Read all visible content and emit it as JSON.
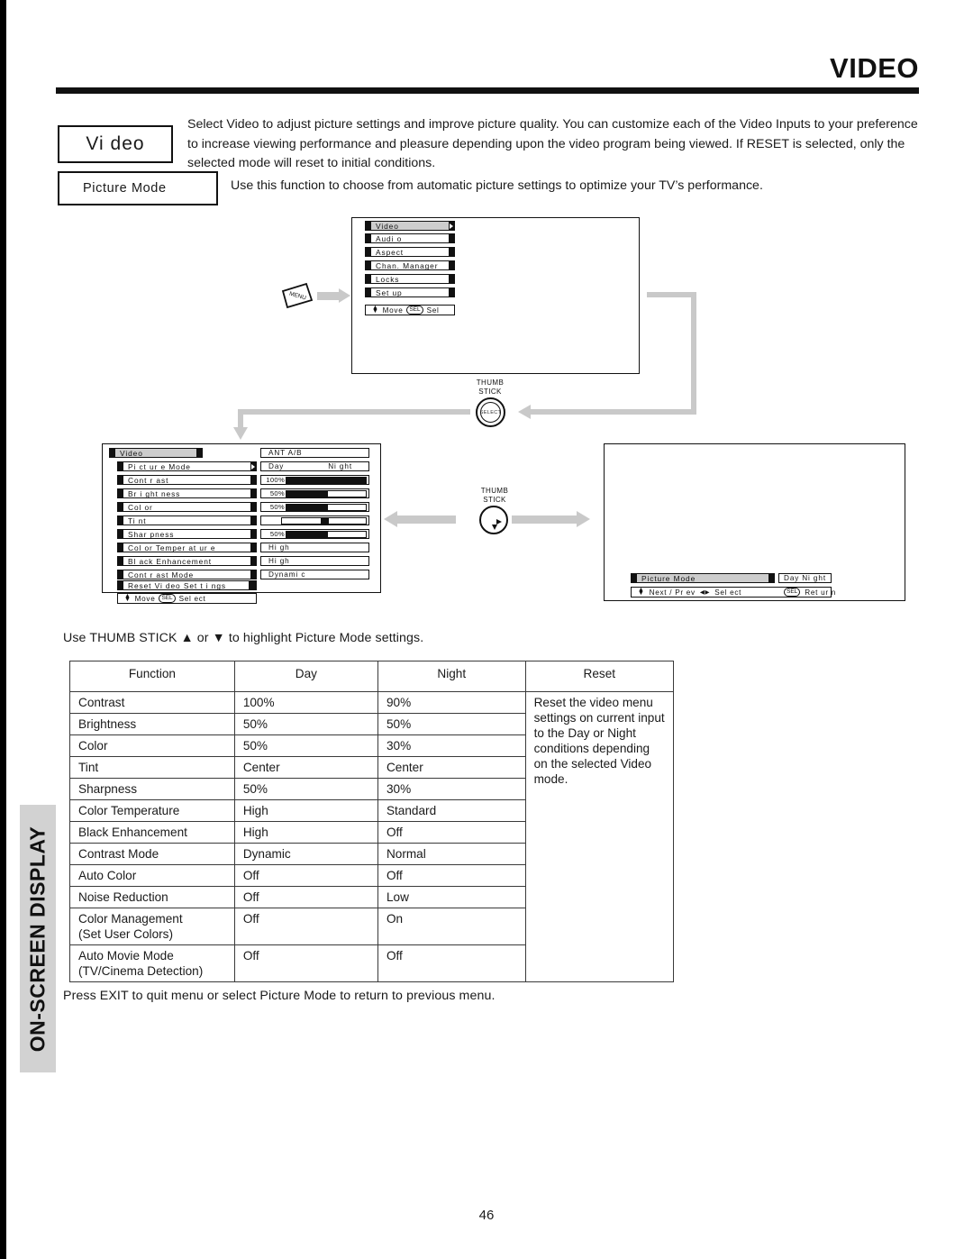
{
  "page": {
    "header_title": "VIDEO",
    "page_number": "46",
    "sidebar_label": "ON-SCREEN DISPLAY"
  },
  "intro": {
    "badge": "Vi deo",
    "paragraph": "Select Video to adjust picture settings and improve picture quality.  You can customize each of the Video Inputs to your preference to increase viewing performance and pleasure depending upon the video program being viewed.  If RESET is selected, only the selected mode will reset to initial conditions.",
    "feature_badge": "Picture Mode",
    "feature_text": "Use this function to choose from automatic picture settings to optimize your TV’s performance."
  },
  "diagram": {
    "menu_key_label": "MENU",
    "thumb_stick_label_1": "THUMB",
    "thumb_stick_label_2": "STICK",
    "select_label": "SELECT",
    "main_menu": {
      "items": [
        "Video",
        "Audi o",
        "Aspect",
        "Chan.  Manager",
        "Locks",
        "Set up"
      ],
      "selected": "Video",
      "guide_move": "Move",
      "guide_sel_key": "SEL",
      "guide_sel": "Sel"
    },
    "video_menu": {
      "title": "Video",
      "input_label": "ANT A/B",
      "rows": [
        {
          "label": "Pi ct ur e  Mode",
          "type": "submenu",
          "value_day": "Day",
          "value_night": "Ni ght"
        },
        {
          "label": "Cont r ast",
          "type": "bar",
          "pct": "100%",
          "fill": 100
        },
        {
          "label": "Br i ght ness",
          "type": "bar",
          "pct": "50%",
          "fill": 52
        },
        {
          "label": "Col or",
          "type": "bar",
          "pct": "50%",
          "fill": 52
        },
        {
          "label": "Ti nt",
          "type": "center",
          "pct": "",
          "fill": 50
        },
        {
          "label": "Shar pness",
          "type": "bar",
          "pct": "50%",
          "fill": 52
        },
        {
          "label": "Col or   Temper at ur e",
          "type": "text",
          "value": "Hi gh"
        },
        {
          "label": "Bl ack  Enhancement",
          "type": "text",
          "value": "Hi gh"
        },
        {
          "label": "Cont r ast   Mode",
          "type": "text",
          "value": "Dynami c"
        },
        {
          "label": "Reset   Vi deo  Set t i ngs",
          "type": "scroll",
          "value": ""
        }
      ],
      "guide_move": "Move",
      "guide_sel_key": "SEL",
      "guide_sel": "Sel ect"
    },
    "picture_mode_bar": {
      "label": "Picture Mode",
      "value_day": "Day",
      "value_night": "Ni ght",
      "guide_nextprev": "Next / Pr ev",
      "guide_select": "Sel ect",
      "guide_return_key": "SEL",
      "guide_return": "Ret ur n"
    }
  },
  "instructions": {
    "above_table": "Use THUMB STICK ▲ or ▼ to highlight Picture Mode settings.",
    "below_table": "Press EXIT to quit menu or select Picture Mode to return to previous menu."
  },
  "table": {
    "headers": [
      "Function",
      "Day",
      "Night",
      "Reset"
    ],
    "rows": [
      {
        "function": "Contrast",
        "day": "100%",
        "night": "90%"
      },
      {
        "function": "Brightness",
        "day": "50%",
        "night": "50%"
      },
      {
        "function": "Color",
        "day": "50%",
        "night": "30%"
      },
      {
        "function": "Tint",
        "day": "Center",
        "night": "Center"
      },
      {
        "function": "Sharpness",
        "day": "50%",
        "night": "30%"
      },
      {
        "function": "Color Temperature",
        "day": "High",
        "night": "Standard"
      },
      {
        "function": "Black Enhancement",
        "day": "High",
        "night": "Off"
      },
      {
        "function": "Contrast Mode",
        "day": "Dynamic",
        "night": "Normal"
      },
      {
        "function": "Auto Color",
        "day": "Off",
        "night": "Off"
      },
      {
        "function": "Noise Reduction",
        "day": "Off",
        "night": "Low"
      },
      {
        "function": "Color Management\n(Set User Colors)",
        "day": "Off",
        "night": "On"
      },
      {
        "function": "Auto Movie Mode\n(TV/Cinema Detection)",
        "day": "Off",
        "night": "Off"
      }
    ],
    "reset_note": "Reset the video menu settings on current input to the Day or Night conditions depending on the selected Video mode."
  },
  "colors": {
    "ink": "#111111",
    "arrow_gray": "#c9c9c9",
    "highlight_gray": "#cdcdcd",
    "sidebar_gray": "#d2d2d2"
  },
  "chart_data": null
}
